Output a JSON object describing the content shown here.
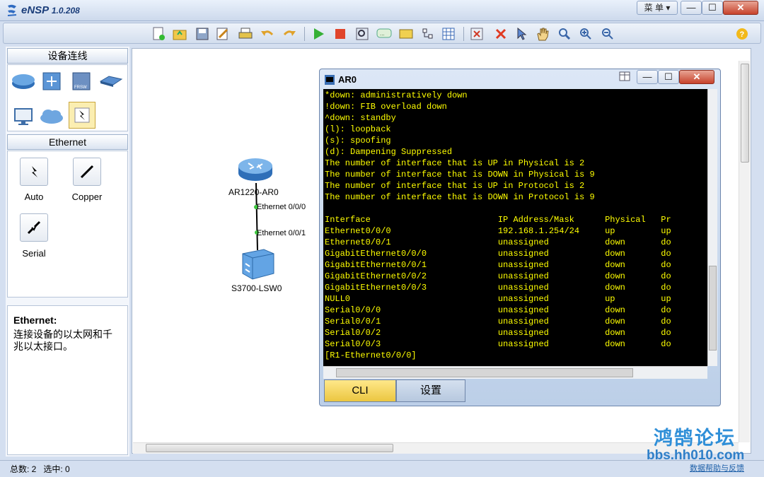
{
  "app": {
    "title": "eNSP",
    "version": "1.0.208",
    "menu": "菜 单"
  },
  "left_panel": {
    "devices_header": "设备连线",
    "ethernet_header": "Ethernet",
    "cables": [
      "Auto",
      "Copper",
      "Serial"
    ],
    "info_title": "Ethernet:",
    "info_text": "连接设备的以太网和千兆以太接口。"
  },
  "topology": {
    "router": "AR1220-AR0",
    "switch": "S3700-LSW0",
    "router_port": "Ethernet 0/0/0",
    "switch_port": "Ethernet 0/0/1"
  },
  "cli": {
    "title": "AR0",
    "tab_cli": "CLI",
    "tab_settings": "设置",
    "lines": [
      "*down: administratively down",
      "!down: FIB overload down",
      "^down: standby",
      "(l): loopback",
      "(s): spoofing",
      "(d): Dampening Suppressed",
      "The number of interface that is UP in Physical is 2",
      "The number of interface that is DOWN in Physical is 9",
      "The number of interface that is UP in Protocol is 2",
      "The number of interface that is DOWN in Protocol is 9",
      "",
      "Interface                         IP Address/Mask      Physical   Pr",
      "Ethernet0/0/0                     192.168.1.254/24     up         up",
      "Ethernet0/0/1                     unassigned           down       do",
      "GigabitEthernet0/0/0              unassigned           down       do",
      "GigabitEthernet0/0/1              unassigned           down       do",
      "GigabitEthernet0/0/2              unassigned           down       do",
      "GigabitEthernet0/0/3              unassigned           down       do",
      "NULL0                             unassigned           up         up",
      "Serial0/0/0                       unassigned           down       do",
      "Serial0/0/1                       unassigned           down       do",
      "Serial0/0/2                       unassigned           down       do",
      "Serial0/0/3                       unassigned           down       do",
      "[R1-Ethernet0/0/0]"
    ]
  },
  "status": {
    "total": "总数: 2",
    "selected": "选中: 0"
  },
  "watermark": {
    "brand": "鸿鹄论坛",
    "url": "bbs.hh010.com",
    "link": "数据帮助与反馈"
  },
  "icons": [
    "new-topology-icon",
    "open-icon",
    "save-icon",
    "save-as-icon",
    "print-icon",
    "undo-icon",
    "redo-icon",
    "start-icon",
    "stop-icon",
    "capture-icon",
    "terminal-icon",
    "note-icon",
    "rectangle-icon",
    "table-icon",
    "delete-all-icon",
    "delete-icon",
    "select-icon",
    "pan-icon",
    "zoom-fit-icon",
    "zoom-in-icon",
    "zoom-out-icon",
    "help-icon"
  ],
  "colors": {
    "terminal_bg": "#000000",
    "terminal_fg": "#ffff00",
    "cli_tab_active": "#f2cf4c",
    "port_dot": "#3cc43c"
  }
}
